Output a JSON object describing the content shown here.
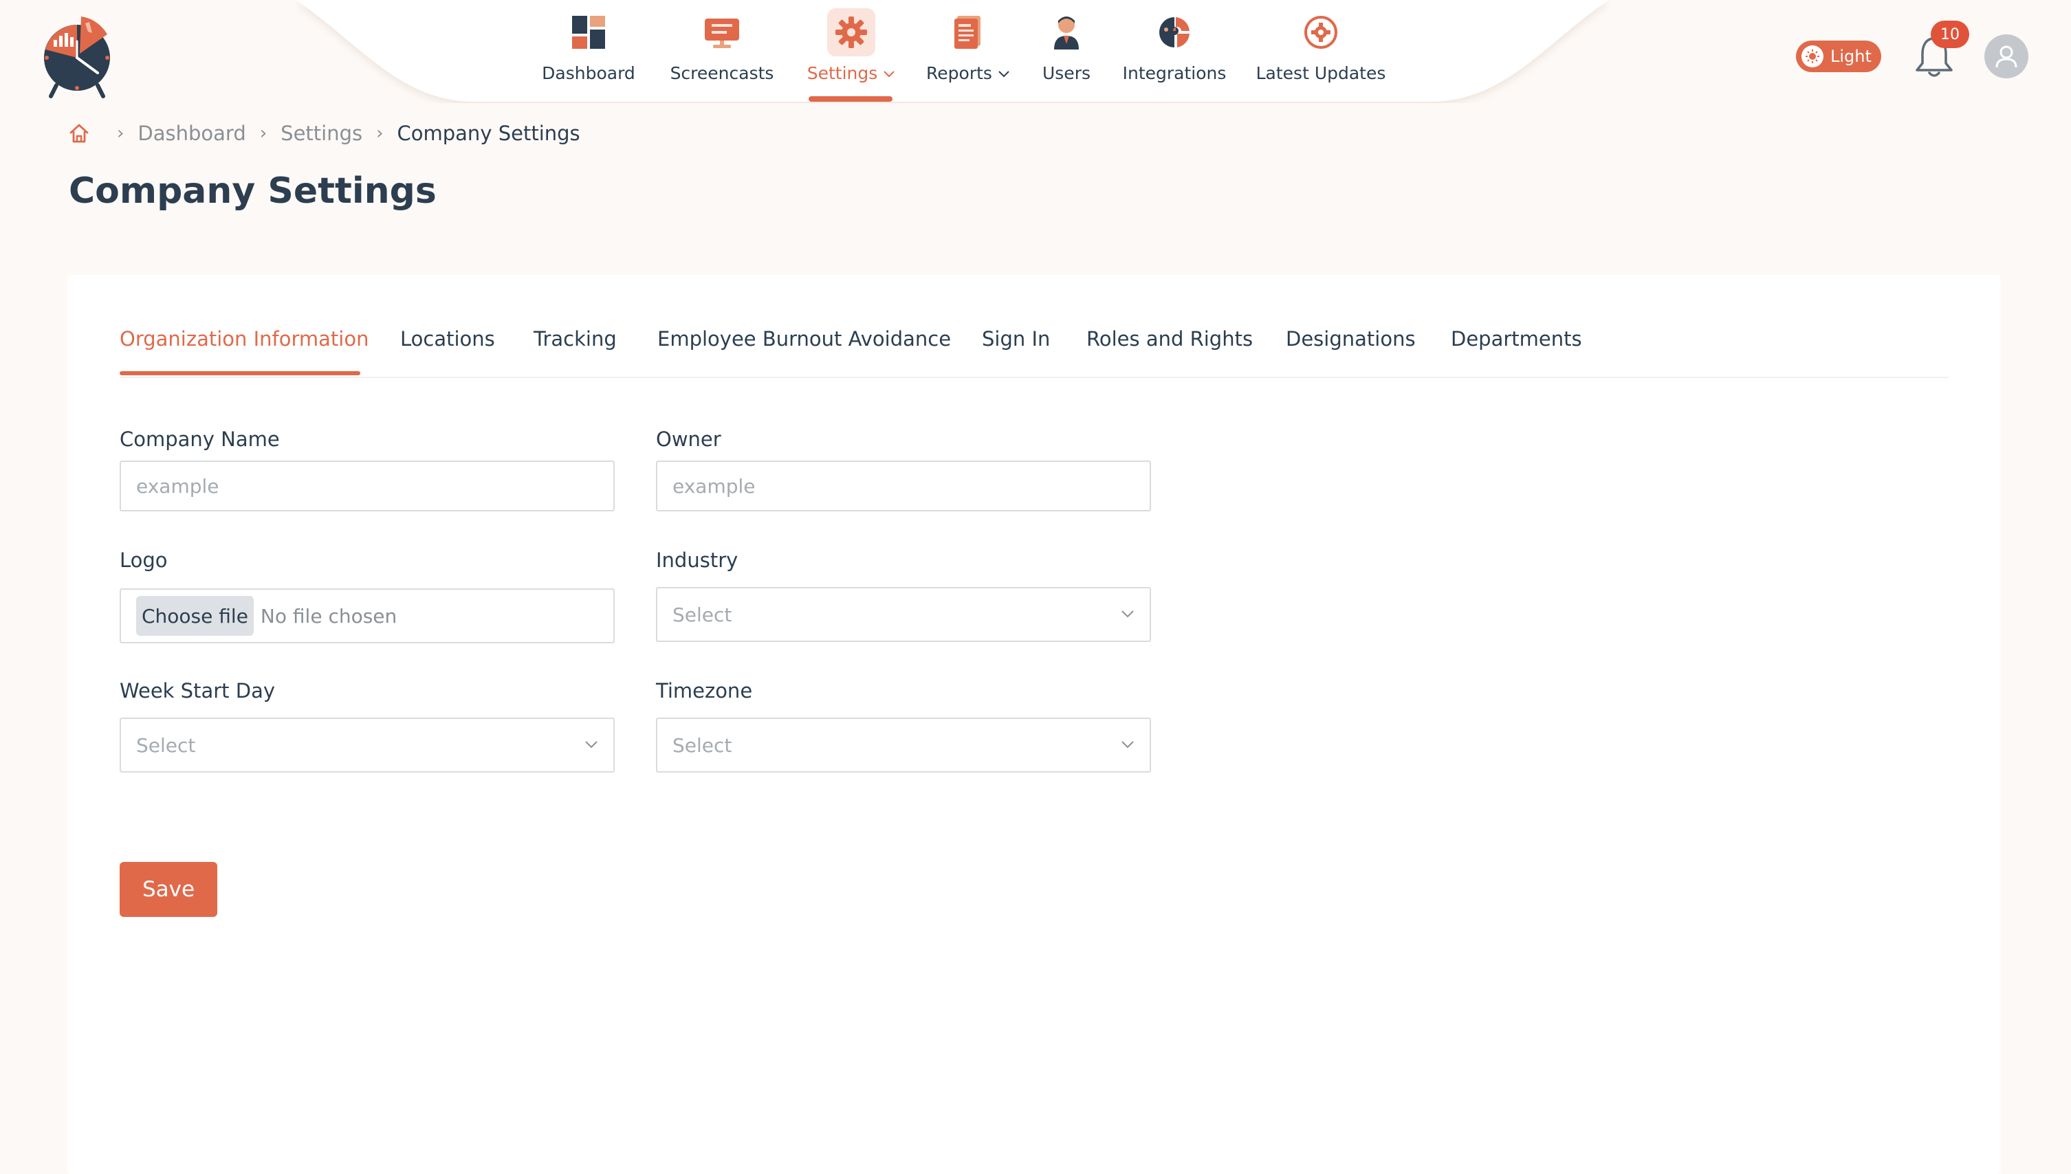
{
  "theme": {
    "accent": "#e0694a",
    "text": "#2c3e50",
    "muted": "#8a8f96",
    "background": "#fdf9f6"
  },
  "nav": {
    "items": [
      {
        "label": "Dashboard",
        "icon": "dashboard-icon"
      },
      {
        "label": "Screencasts",
        "icon": "screencast-icon"
      },
      {
        "label": "Settings",
        "icon": "gear-icon",
        "active": true,
        "dropdown": true
      },
      {
        "label": "Reports",
        "icon": "report-icon",
        "dropdown": true
      },
      {
        "label": "Users",
        "icon": "user-icon"
      },
      {
        "label": "Integrations",
        "icon": "puzzle-icon"
      },
      {
        "label": "Latest Updates",
        "icon": "updates-icon"
      }
    ]
  },
  "header": {
    "theme_label": "Light",
    "notification_count": "10"
  },
  "breadcrumb": {
    "items": [
      "Dashboard",
      "Settings",
      "Company Settings"
    ],
    "home_icon": "home-icon"
  },
  "page": {
    "title": "Company Settings"
  },
  "tabs": [
    {
      "label": "Organization Information",
      "active": true
    },
    {
      "label": "Locations"
    },
    {
      "label": "Tracking"
    },
    {
      "label": "Employee Burnout Avoidance"
    },
    {
      "label": "Sign In"
    },
    {
      "label": "Roles and Rights"
    },
    {
      "label": "Designations"
    },
    {
      "label": "Departments"
    }
  ],
  "form": {
    "company_name": {
      "label": "Company Name",
      "placeholder": "example",
      "value": ""
    },
    "owner": {
      "label": "Owner",
      "placeholder": "example",
      "value": ""
    },
    "logo": {
      "label": "Logo",
      "button": "Choose file",
      "status": "No file chosen"
    },
    "industry": {
      "label": "Industry",
      "selected": "Select"
    },
    "week_start_day": {
      "label": "Week Start Day",
      "selected": "Select"
    },
    "timezone": {
      "label": "Timezone",
      "selected": "Select"
    },
    "save_label": "Save"
  }
}
